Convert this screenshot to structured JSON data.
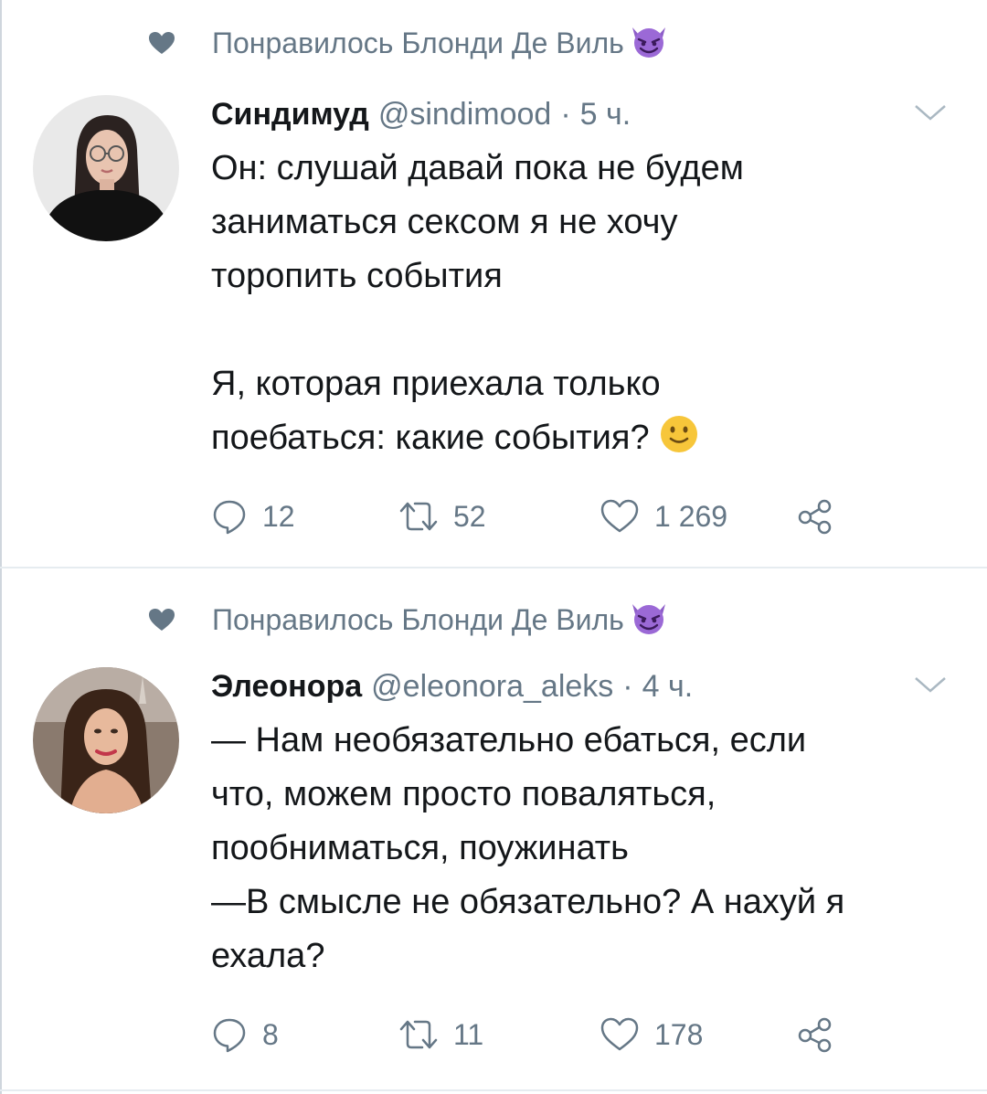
{
  "tweets": [
    {
      "social_context": "Понравилось Блонди Де Виль",
      "author_name": "Синдимуд",
      "handle": "@sindimood",
      "separator": "·",
      "time": "5 ч.",
      "text_lines": [
        "Он: слушай давай пока не будем",
        "заниматься сексом я не хочу",
        "торопить события",
        "",
        "Я, которая приехала только",
        "поебаться: какие события?"
      ],
      "replies": "12",
      "retweets": "52",
      "likes": "1 269"
    },
    {
      "social_context": "Понравилось Блонди Де Виль",
      "author_name": "Элеонора",
      "handle": "@eleonora_aleks",
      "separator": "·",
      "time": "4 ч.",
      "text_lines": [
        "— Нам необязательно ебаться, если",
        "что, можем просто поваляться,",
        "пообниматься, поужинать",
        "—В смысле не обязательно? А нахуй я",
        "ехала?"
      ],
      "replies": "8",
      "retweets": "11",
      "likes": "178"
    }
  ],
  "icons": {
    "social_heart": "heart-filled-icon",
    "devil": "smiling-devil-emoji",
    "smiley": "slightly-smiling-face-emoji",
    "caret": "chevron-down-icon",
    "reply": "reply-bubble-icon",
    "retweet": "retweet-icon",
    "like": "heart-outline-icon",
    "share": "share-icon"
  },
  "colors": {
    "text": "#14171a",
    "secondary": "#657786",
    "divider": "#e6ecf0",
    "devil": "#8e5ec9",
    "smiley": "#f7c63a"
  }
}
